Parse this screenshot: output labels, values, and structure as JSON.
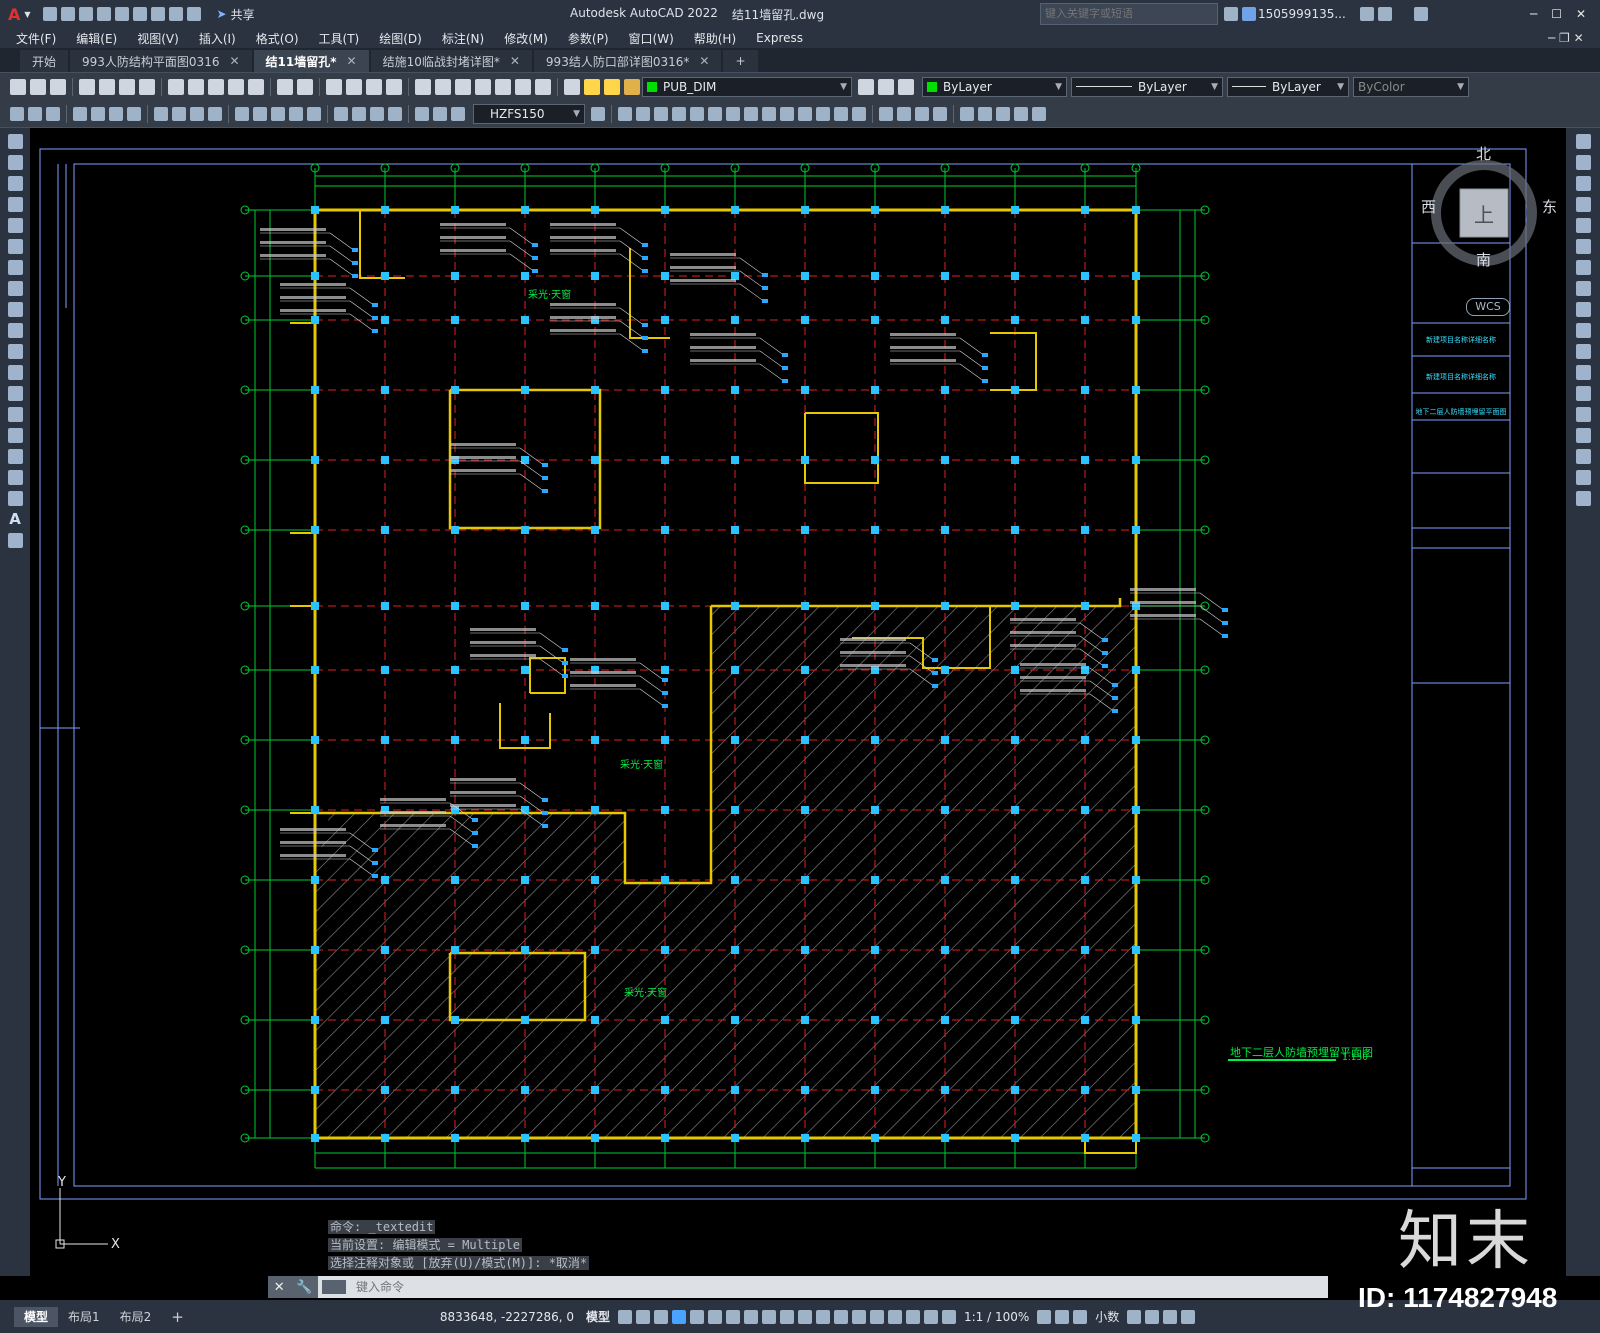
{
  "app": {
    "title": "Autodesk AutoCAD 2022",
    "file": "结11墙留孔.dwg",
    "search_placeholder": "键入关键字或短语",
    "user": "1505999135...",
    "share": "共享"
  },
  "menu": [
    "文件(F)",
    "编辑(E)",
    "视图(V)",
    "插入(I)",
    "格式(O)",
    "工具(T)",
    "绘图(D)",
    "标注(N)",
    "修改(M)",
    "参数(P)",
    "窗口(W)",
    "帮助(H)",
    "Express"
  ],
  "tabs": [
    {
      "label": "开始",
      "active": false
    },
    {
      "label": "993人防结构平面图0316",
      "active": false
    },
    {
      "label": "结11墙留孔*",
      "active": true
    },
    {
      "label": "结施10临战封堵详图*",
      "active": false
    },
    {
      "label": "993结人防口部详图0316*",
      "active": false
    }
  ],
  "toolbar": {
    "layer": "PUB_DIM",
    "color": "ByLayer",
    "linetype": "ByLayer",
    "lineweight": "ByLayer",
    "plotstyle": "ByColor",
    "dimstyle": "HZFS150"
  },
  "viewcube": {
    "north": "北",
    "south": "南",
    "east": "东",
    "west": "西",
    "top": "上",
    "wcs": "WCS"
  },
  "drawing": {
    "title": "地下二层人防墙预埋留平面图",
    "scale": "1:150",
    "label_a": "采光·天窗",
    "title_block": [
      "新建项目名称详细名称",
      "新建项目名称详细名称",
      "地下二层人防墙预埋留平面图"
    ]
  },
  "command": {
    "history": [
      "命令: _textedit",
      "当前设置: 编辑模式 = Multiple",
      "选择注释对象或 [放弃(U)/模式(M)]: *取消*"
    ],
    "placeholder": "键入命令"
  },
  "status": {
    "layouts": [
      {
        "label": "模型",
        "active": true
      },
      {
        "label": "布局1",
        "active": false
      },
      {
        "label": "布局2",
        "active": false
      }
    ],
    "coords": "8833648, -2227286, 0",
    "space": "模型",
    "scale": "1:1 / 100%",
    "units": "小数"
  },
  "watermark": {
    "brand": "知末",
    "id": "ID: 1174827948"
  },
  "colors": {
    "grid_axis": "#00cc33",
    "grid_dash": "#e02020",
    "wall": "#e6c800",
    "column": "#29c3ff",
    "hatch": "#8a8a8a",
    "frame": "#7f9cff"
  }
}
